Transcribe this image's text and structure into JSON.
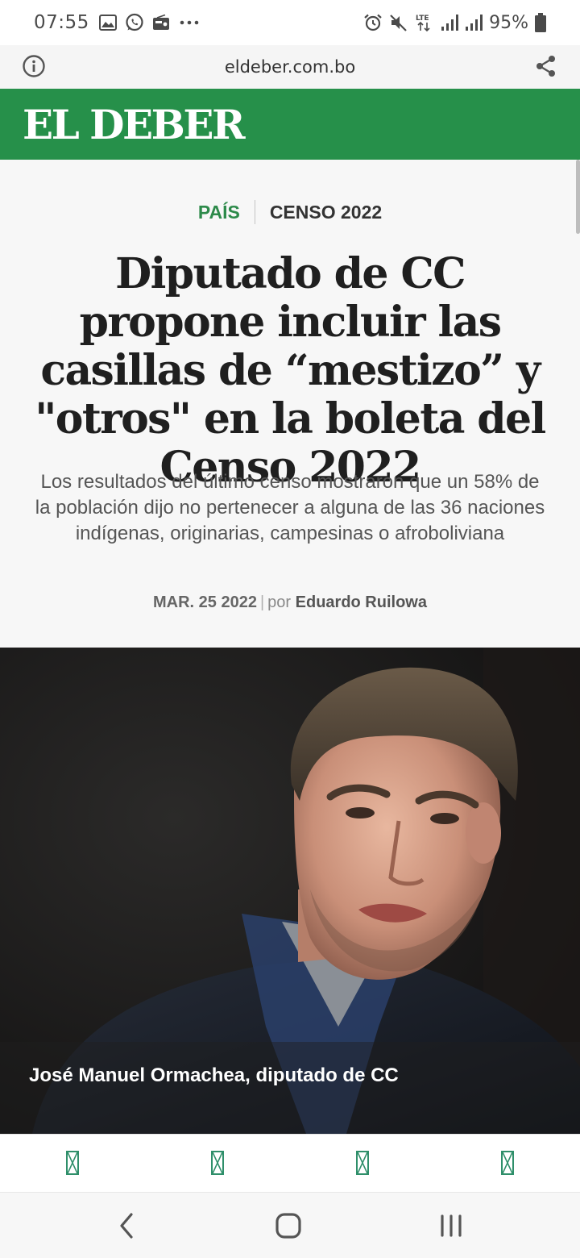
{
  "status_bar": {
    "time": "07:55",
    "battery": "95%",
    "network": "LTE",
    "left_icons": [
      "gallery-icon",
      "whatsapp-icon",
      "radio-icon",
      "more-dots-icon"
    ],
    "right_icons": [
      "alarm-icon",
      "mute-icon",
      "lte-icon",
      "signal-icon",
      "signal-icon",
      "battery-icon"
    ]
  },
  "url_bar": {
    "url": "eldeber.com.bo",
    "left_icon": "info-icon",
    "right_icon": "share-icon"
  },
  "brand": {
    "logo_text": "EL DEBER",
    "color": "#26904a"
  },
  "article": {
    "category_primary": "PAÍS",
    "category_secondary": "CENSO 2022",
    "headline": "Diputado de CC propone incluir las casillas de “mestizo” y \"otros\" en la boleta del Censo 2022",
    "deck": "Los resultados del último censo mostraron que un 58% de la población dijo no pertenecer a alguna de las 36 naciones indígenas, originarias, campesinas o afroboliviana",
    "date": "MAR. 25 2022",
    "byline_prefix": "por",
    "author": "Eduardo Ruilowa",
    "accent_color": "#2d8a4a"
  },
  "hero": {
    "caption": "José Manuel Ormachea, diputado de CC"
  },
  "toolbar": {
    "icons": [
      "missing-glyph-icon",
      "missing-glyph-icon",
      "missing-glyph-icon",
      "missing-glyph-icon"
    ],
    "icon_color": "#2f8f6a"
  },
  "nav_bar": {
    "icons": [
      "back-icon",
      "home-icon",
      "recent-apps-icon"
    ]
  }
}
